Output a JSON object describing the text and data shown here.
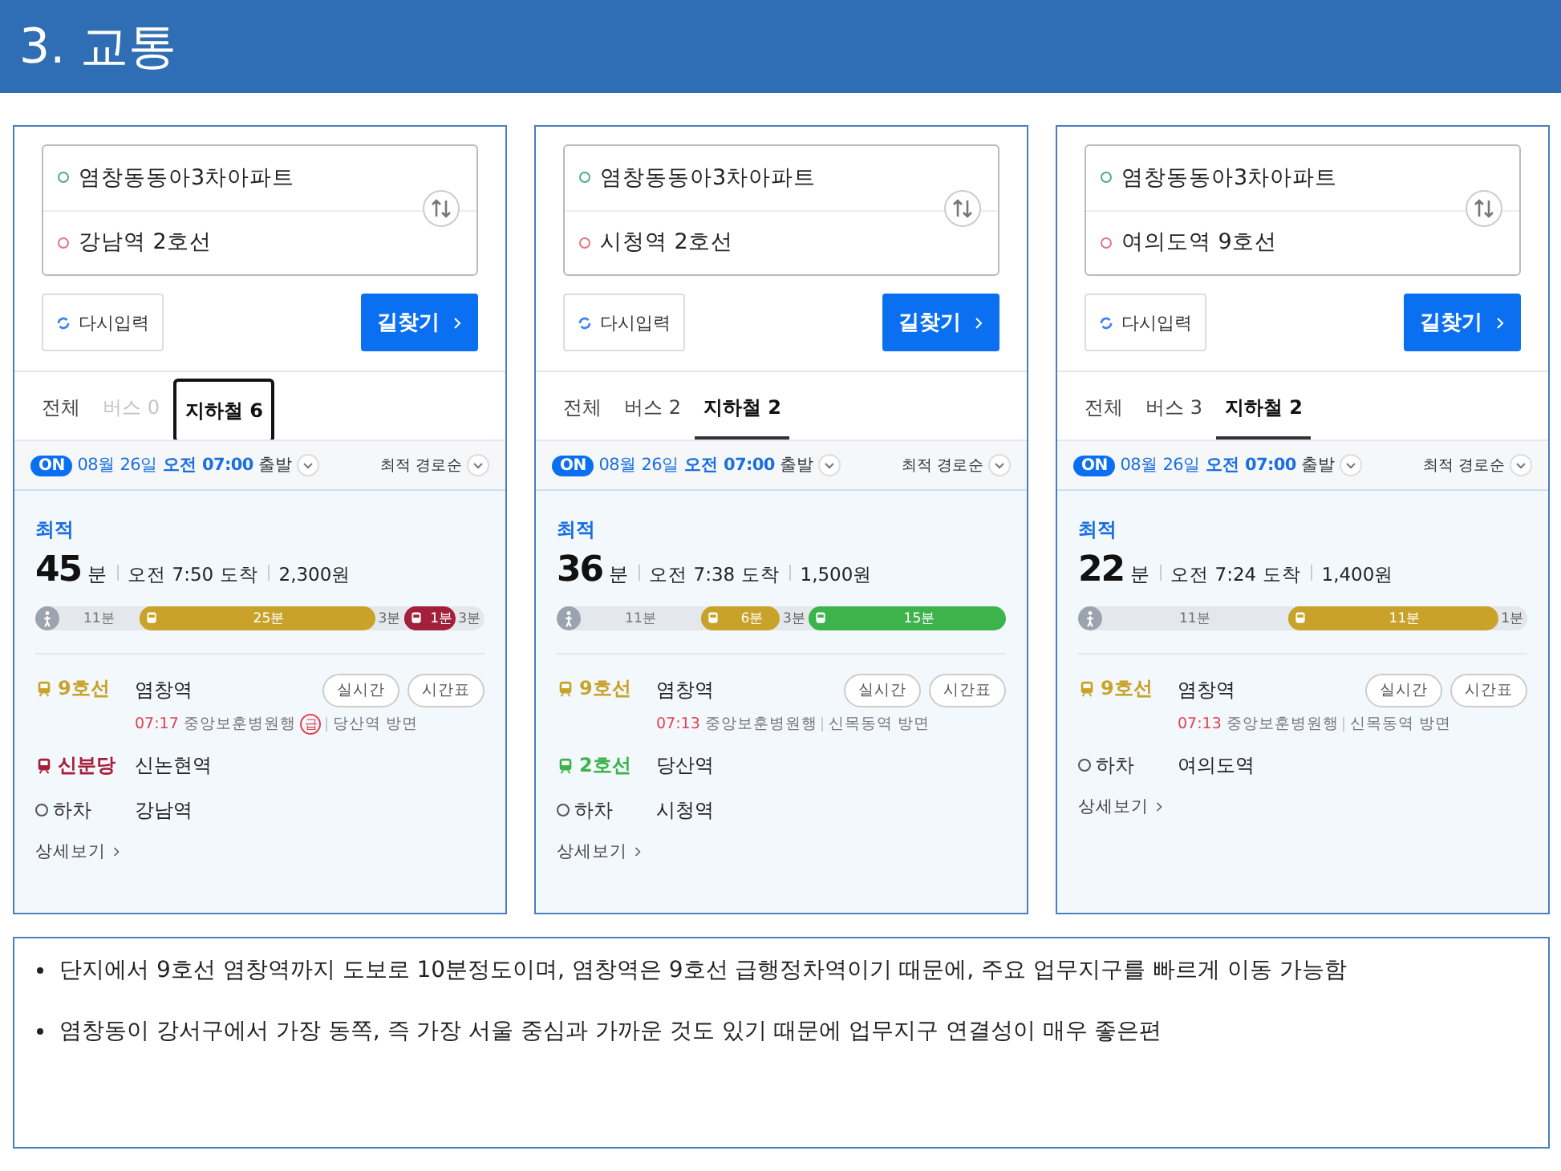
{
  "title": "3. 교통",
  "panels": [
    {
      "origin": "염창동동아3차아파트",
      "destination": "강남역 2호선",
      "reset": "다시입력",
      "search": "길찾기",
      "tabs": [
        {
          "label": "전체",
          "selected": false,
          "disabled": false,
          "boxed": false
        },
        {
          "label": "버스 0",
          "selected": false,
          "disabled": true,
          "boxed": false
        },
        {
          "label": "지하철 6",
          "selected": true,
          "disabled": false,
          "boxed": true
        }
      ],
      "departure": {
        "badge": "ON",
        "date": "08월 26일",
        "time": "오전 07:00",
        "label": "출발"
      },
      "sort": "최적 경로순",
      "route": {
        "tag": "최적",
        "duration": "45",
        "unit": "분",
        "arrival": "오전 7:50 도착",
        "fare": "2,300원"
      },
      "segments": [
        {
          "kind": "walk",
          "label": "11분"
        },
        {
          "kind": "ride",
          "label": "25분",
          "color": "#c9a22a"
        },
        {
          "kind": "gap",
          "label": "3분"
        },
        {
          "kind": "ride",
          "label": "1분",
          "color": "#a3203a"
        },
        {
          "kind": "gap",
          "label": "3분"
        }
      ],
      "steps": [
        {
          "kind": "ride",
          "line": "9호선",
          "color": "#c9a22a",
          "station": "염창역",
          "buttons": [
            "실시간",
            "시간표"
          ],
          "time": "07:17",
          "train": "중앙보훈병원행",
          "express": "급",
          "direction": "당산역 방면"
        },
        {
          "kind": "ride",
          "line": "신분당",
          "color": "#a3203a",
          "station": "신논현역"
        },
        {
          "kind": "alight",
          "line": "하차",
          "station": "강남역"
        }
      ],
      "more": "상세보기"
    },
    {
      "origin": "염창동동아3차아파트",
      "destination": "시청역 2호선",
      "reset": "다시입력",
      "search": "길찾기",
      "tabs": [
        {
          "label": "전체",
          "selected": false,
          "disabled": false,
          "boxed": false
        },
        {
          "label": "버스 2",
          "selected": false,
          "disabled": false,
          "boxed": false
        },
        {
          "label": "지하철 2",
          "selected": true,
          "disabled": false,
          "boxed": false
        }
      ],
      "departure": {
        "badge": "ON",
        "date": "08월 26일",
        "time": "오전 07:00",
        "label": "출발"
      },
      "sort": "최적 경로순",
      "route": {
        "tag": "최적",
        "duration": "36",
        "unit": "분",
        "arrival": "오전 7:38 도착",
        "fare": "1,500원"
      },
      "segments": [
        {
          "kind": "walk",
          "label": "11분"
        },
        {
          "kind": "ride",
          "label": "6분",
          "color": "#c9a22a"
        },
        {
          "kind": "gap",
          "label": "3분"
        },
        {
          "kind": "ride",
          "label": "15분",
          "color": "#3cb44b"
        }
      ],
      "steps": [
        {
          "kind": "ride",
          "line": "9호선",
          "color": "#c9a22a",
          "station": "염창역",
          "buttons": [
            "실시간",
            "시간표"
          ],
          "time": "07:13",
          "train": "중앙보훈병원행",
          "direction": "신목동역 방면"
        },
        {
          "kind": "ride",
          "line": "2호선",
          "color": "#3cb44b",
          "station": "당산역"
        },
        {
          "kind": "alight",
          "line": "하차",
          "station": "시청역"
        }
      ],
      "more": "상세보기"
    },
    {
      "origin": "염창동동아3차아파트",
      "destination": "여의도역 9호선",
      "reset": "다시입력",
      "search": "길찾기",
      "tabs": [
        {
          "label": "전체",
          "selected": false,
          "disabled": false,
          "boxed": false
        },
        {
          "label": "버스 3",
          "selected": false,
          "disabled": false,
          "boxed": false
        },
        {
          "label": "지하철 2",
          "selected": true,
          "disabled": false,
          "boxed": false
        }
      ],
      "departure": {
        "badge": "ON",
        "date": "08월 26일",
        "time": "오전 07:00",
        "label": "출발"
      },
      "sort": "최적 경로순",
      "route": {
        "tag": "최적",
        "duration": "22",
        "unit": "분",
        "arrival": "오전 7:24 도착",
        "fare": "1,400원"
      },
      "segments": [
        {
          "kind": "walk",
          "label": "11분"
        },
        {
          "kind": "ride",
          "label": "11분",
          "color": "#c9a22a"
        },
        {
          "kind": "gap",
          "label": "1분"
        }
      ],
      "steps": [
        {
          "kind": "ride",
          "line": "9호선",
          "color": "#c9a22a",
          "station": "염창역",
          "buttons": [
            "실시간",
            "시간표"
          ],
          "time": "07:13",
          "train": "중앙보훈병원행",
          "direction": "신목동역 방면"
        },
        {
          "kind": "alight",
          "line": "하차",
          "station": "여의도역"
        }
      ],
      "more": "상세보기"
    }
  ],
  "notes": [
    "단지에서 9호선 염창역까지 도보로 10분정도이며, 염창역은 9호선 급행정차역이기 때문에, 주요 업무지구를 빠르게 이동 가능함",
    "염창동이 강서구에서 가장 동쪽, 즉 가장 서울 중심과 가까운 것도 있기 때문에 업무지구 연결성이 매우 좋은편"
  ]
}
